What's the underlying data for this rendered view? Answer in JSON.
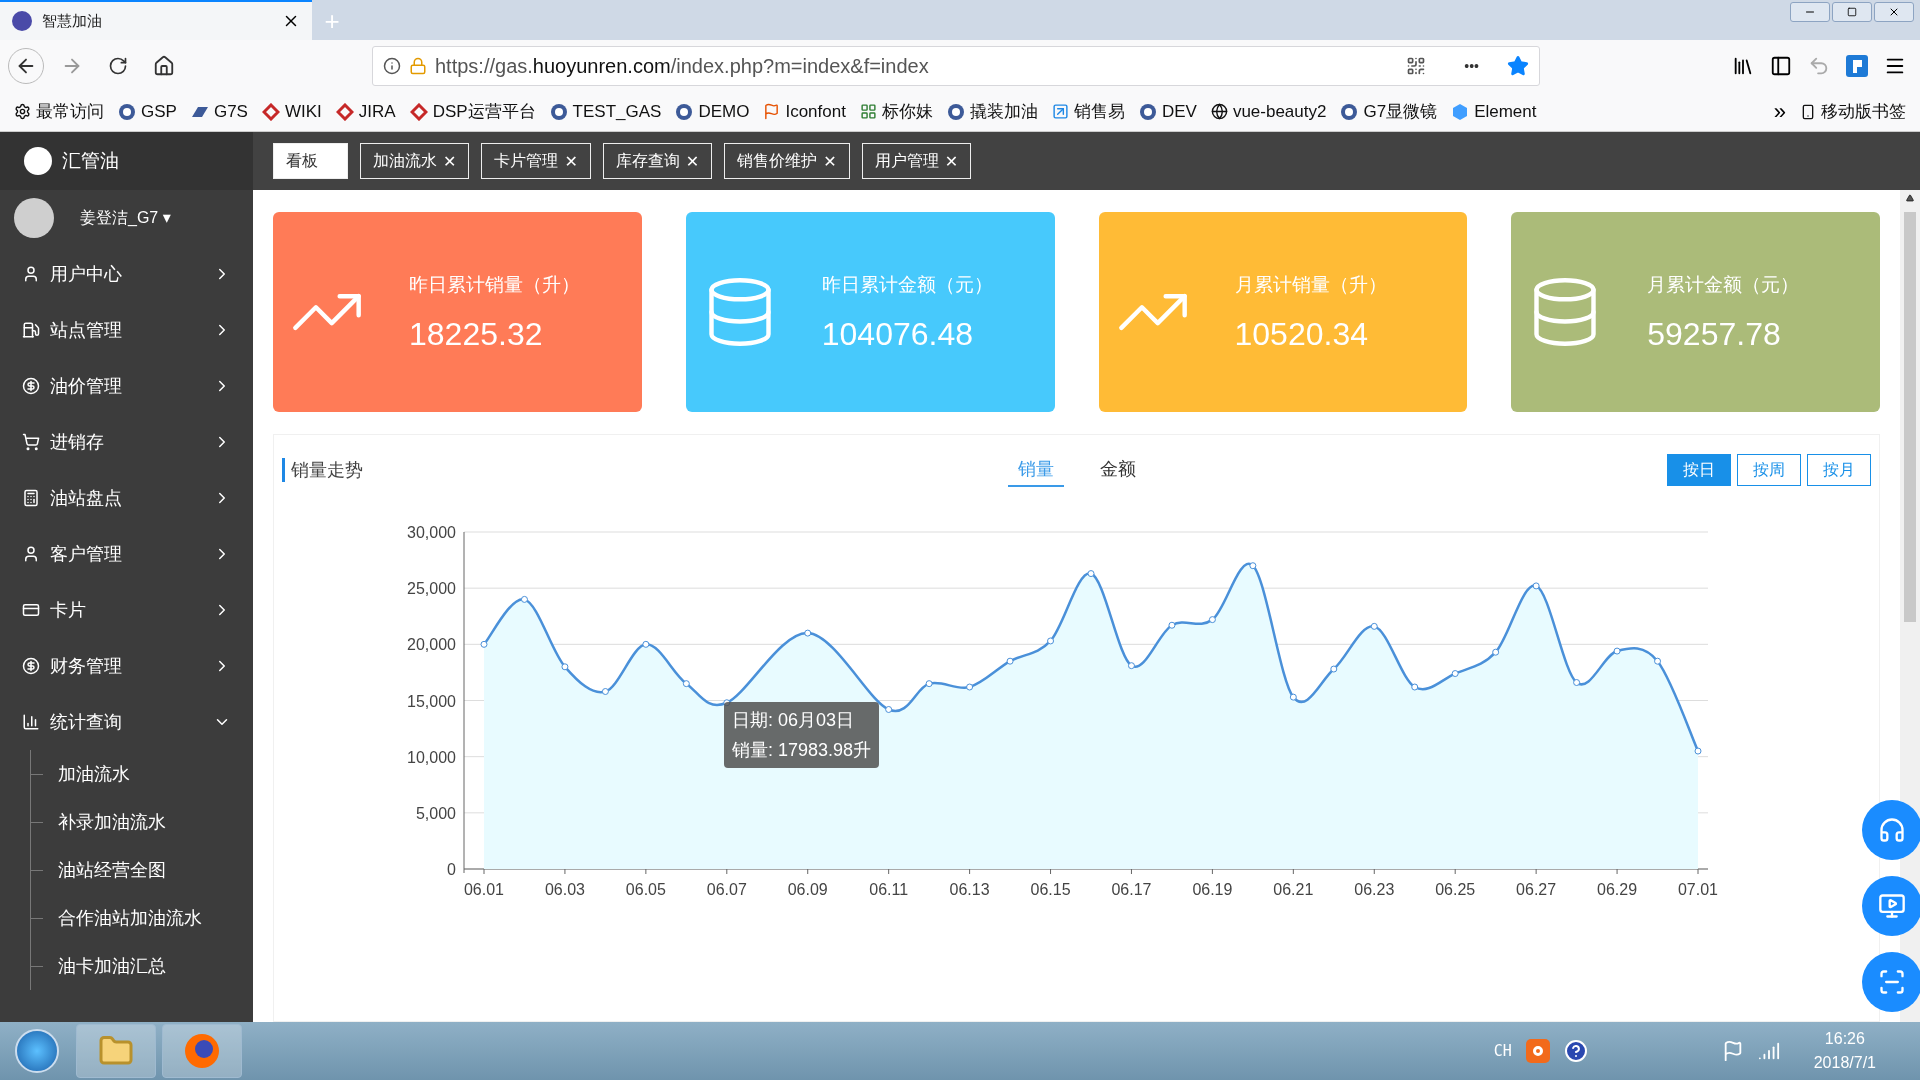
{
  "browser": {
    "tab_title": "智慧加油",
    "new_tab": "+",
    "url_host_prefix": "https://gas.",
    "url_host_main": "huoyunren.com",
    "url_path": "/index.php?m=index&f=index",
    "more": "•••",
    "bookmarks": [
      {
        "label": "最常访问"
      },
      {
        "label": "GSP"
      },
      {
        "label": "G7S"
      },
      {
        "label": "WIKI"
      },
      {
        "label": "JIRA"
      },
      {
        "label": "DSP运营平台"
      },
      {
        "label": "TEST_GAS"
      },
      {
        "label": "DEMO"
      },
      {
        "label": "Iconfont"
      },
      {
        "label": "标你妹"
      },
      {
        "label": "撬装加油"
      },
      {
        "label": "销售易"
      },
      {
        "label": "DEV"
      },
      {
        "label": "vue-beauty2"
      },
      {
        "label": "G7显微镜"
      },
      {
        "label": "Element"
      }
    ],
    "overflow": "»",
    "mobile_bookmarks": "移动版书签"
  },
  "app": {
    "logo": "汇管油",
    "user": "姜登洁_G7",
    "user_caret": "▾",
    "menu": [
      {
        "label": "用户中心",
        "expanded": false
      },
      {
        "label": "站点管理",
        "expanded": false
      },
      {
        "label": "油价管理",
        "expanded": false
      },
      {
        "label": "进销存",
        "expanded": false
      },
      {
        "label": "油站盘点",
        "expanded": false
      },
      {
        "label": "客户管理",
        "expanded": false
      },
      {
        "label": "卡片",
        "expanded": false
      },
      {
        "label": "财务管理",
        "expanded": false
      },
      {
        "label": "统计查询",
        "expanded": true,
        "children": [
          {
            "label": "加油流水"
          },
          {
            "label": "补录加油流水"
          },
          {
            "label": "油站经营全图"
          },
          {
            "label": "合作油站加油流水"
          },
          {
            "label": "油卡加油汇总"
          }
        ]
      }
    ],
    "tabs": [
      {
        "label": "看板",
        "selected": true,
        "closable": false
      },
      {
        "label": "加油流水",
        "selected": false,
        "closable": true
      },
      {
        "label": "卡片管理",
        "selected": false,
        "closable": true
      },
      {
        "label": "库存查询",
        "selected": false,
        "closable": true
      },
      {
        "label": "销售价维护",
        "selected": false,
        "closable": true
      },
      {
        "label": "用户管理",
        "selected": false,
        "closable": true
      }
    ],
    "close_mark": "✕",
    "cards": [
      {
        "title": "昨日累计销量（升）",
        "value": "18225.32",
        "color": "#ff7b57"
      },
      {
        "title": "昨日累计金额（元）",
        "value": "104076.48",
        "color": "#47c9fc"
      },
      {
        "title": "月累计销量（升）",
        "value": "10520.34",
        "color": "#ffbb36"
      },
      {
        "title": "月累计金额（元）",
        "value": "59257.78",
        "color": "#abbb79"
      }
    ],
    "trend": {
      "title": "销量走势",
      "metric_tabs": [
        {
          "label": "销量",
          "selected": true
        },
        {
          "label": "金额",
          "selected": false
        }
      ],
      "period_buttons": [
        {
          "label": "按日",
          "selected": true
        },
        {
          "label": "按周",
          "selected": false
        },
        {
          "label": "按月",
          "selected": false
        }
      ],
      "tooltip": {
        "date_line": "日期: 06月03日",
        "value_line": "销量: 17983.98升"
      },
      "chart_data": {
        "type": "area",
        "grid": true,
        "categories": [
          "06.01",
          null,
          "06.03",
          null,
          "06.05",
          null,
          "06.07",
          null,
          "06.09",
          null,
          "06.11",
          null,
          "06.13",
          null,
          "06.15",
          null,
          "06.17",
          null,
          "06.19",
          null,
          "06.21",
          null,
          "06.23",
          null,
          "06.25",
          null,
          "06.27",
          null,
          "06.29",
          null,
          "07.01"
        ],
        "series": [
          {
            "color": "#4a90d9",
            "values": [
              20000,
              24000,
              18000,
              15800,
              20000,
              16500,
              14800,
              null,
              21000,
              null,
              14200,
              16500,
              16200,
              18500,
              20300,
              26300,
              18100,
              21700,
              22200,
              27000,
              15300,
              17800,
              21600,
              16200,
              17400,
              19300,
              25200,
              16600,
              19400,
              18500,
              10500
            ]
          }
        ],
        "ylim": [
          0,
          30000
        ],
        "yticks": [
          {
            "value": 0,
            "label": "0"
          },
          {
            "value": 5000,
            "label": "5,000"
          },
          {
            "value": 10000,
            "label": "10,000"
          },
          {
            "value": 15000,
            "label": "15,000"
          },
          {
            "value": 20000,
            "label": "20,000"
          },
          {
            "value": 25000,
            "label": "25,000"
          },
          {
            "value": 30000,
            "label": "30,000"
          }
        ]
      }
    }
  },
  "taskbar": {
    "lang": "CH",
    "time": "16:26",
    "date": "2018/7/1"
  }
}
